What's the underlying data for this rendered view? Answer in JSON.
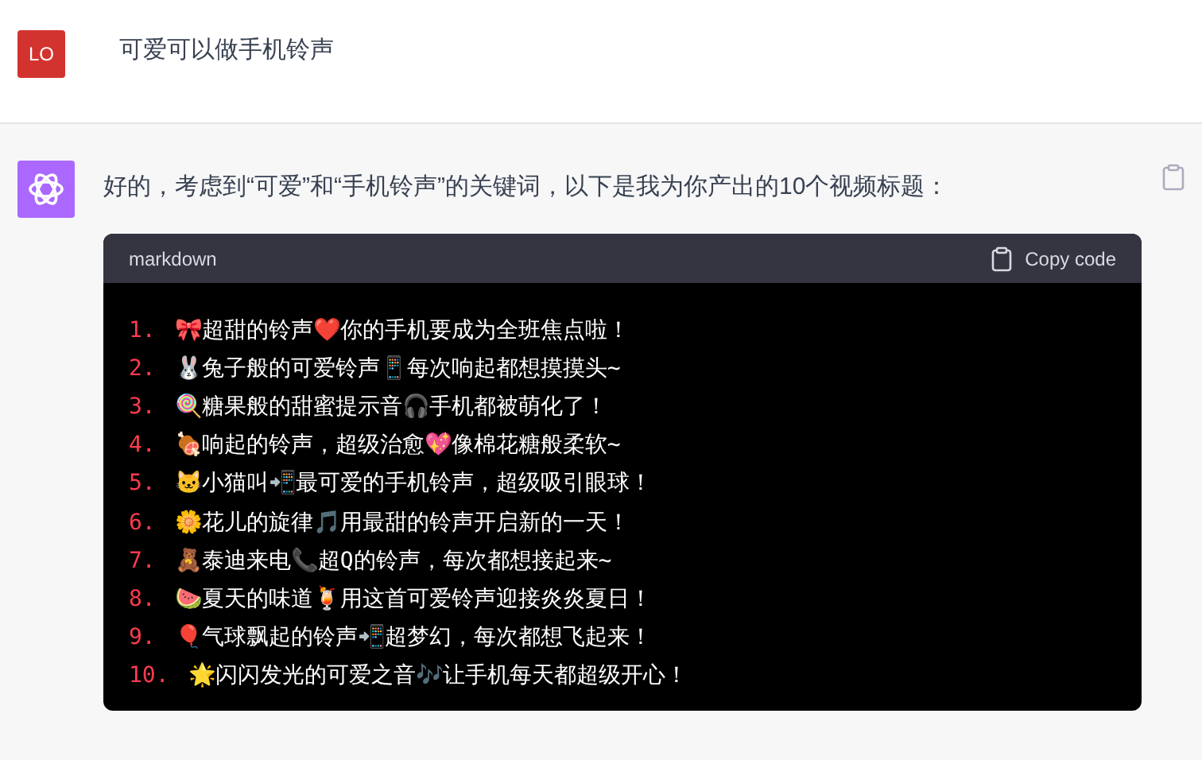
{
  "user_message": {
    "avatar": "LO",
    "text": "可爱可以做手机铃声"
  },
  "assistant_message": {
    "text": "好的，考虑到“可爱”和“手机铃声”的关键词，以下是我为你产出的10个视频标题：",
    "code_block": {
      "language": "markdown",
      "copy_label": "Copy code",
      "lines": [
        {
          "number": "1.",
          "text": "🎀超甜的铃声❤️你的手机要成为全班焦点啦！"
        },
        {
          "number": "2.",
          "text": "🐰兔子般的可爱铃声📱每次响起都想摸摸头~"
        },
        {
          "number": "3.",
          "text": "🍭糖果般的甜蜜提示音🎧手机都被萌化了！"
        },
        {
          "number": "4.",
          "text": "🍖响起的铃声，超级治愈💖像棉花糖般柔软~"
        },
        {
          "number": "5.",
          "text": "🐱小猫叫📲最可爱的手机铃声，超级吸引眼球！"
        },
        {
          "number": "6.",
          "text": "🌼花儿的旋律🎵用最甜的铃声开启新的一天！"
        },
        {
          "number": "7.",
          "text": "🧸泰迪来电📞超Q的铃声，每次都想接起来~"
        },
        {
          "number": "8.",
          "text": "🍉夏天的味道🍹用这首可爱铃声迎接炎炎夏日！"
        },
        {
          "number": "9.",
          "text": "🎈气球飘起的铃声📲超梦幻，每次都想飞起来！"
        },
        {
          "number": "10.",
          "text": " 🌟闪闪发光的可爱之音🎶让手机每天都超级开心！"
        }
      ]
    }
  }
}
